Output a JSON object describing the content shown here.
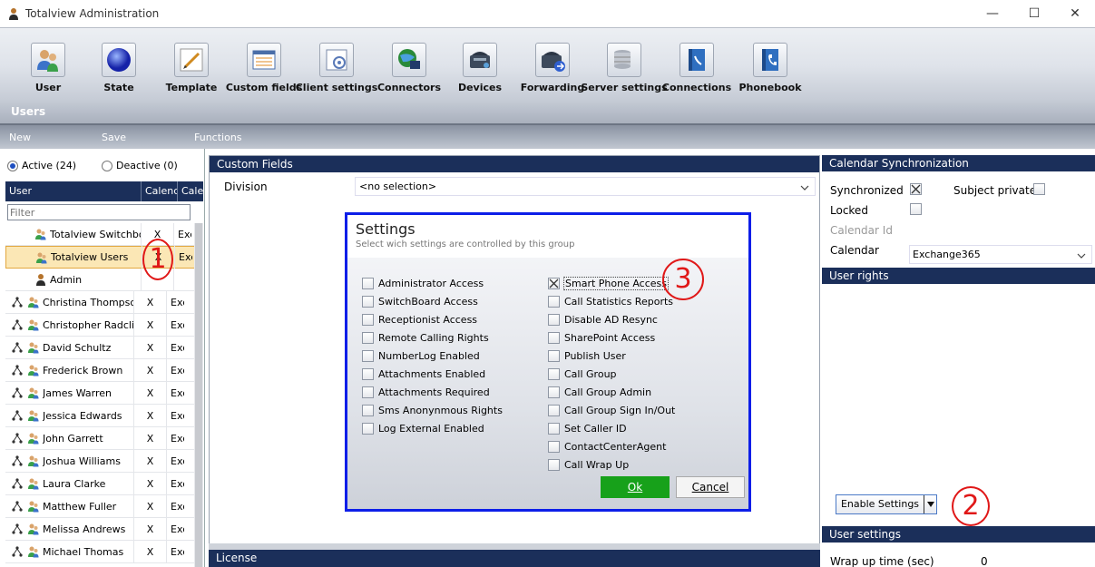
{
  "window": {
    "title": "Totalview  Administration"
  },
  "toolbar": {
    "items": [
      {
        "label": "User",
        "icon": "users-icon"
      },
      {
        "label": "State",
        "icon": "state-orb-icon"
      },
      {
        "label": "Template",
        "icon": "template-pen-icon"
      },
      {
        "label": "Custom fields",
        "icon": "custom-fields-icon"
      },
      {
        "label": "Client settings",
        "icon": "client-settings-icon"
      },
      {
        "label": "Connectors",
        "icon": "connectors-globe-icon"
      },
      {
        "label": "Devices",
        "icon": "devices-phone-icon"
      },
      {
        "label": "Forwarding",
        "icon": "forwarding-phone-icon"
      },
      {
        "label": "Server settings",
        "icon": "server-database-icon"
      },
      {
        "label": "Connections",
        "icon": "connections-book-icon"
      },
      {
        "label": "Phonebook",
        "icon": "phonebook-icon"
      }
    ],
    "section_title": "Users"
  },
  "menu": {
    "new": "New",
    "save": "Save",
    "functions": "Functions"
  },
  "left": {
    "active_label": "Active (24)",
    "deactive_label": "Deactive (0)",
    "columns": [
      "User",
      "Calenc",
      "Cale"
    ],
    "filter_placeholder": "Filter",
    "rows": [
      {
        "name": "Totalview Switchboa",
        "cal": "X",
        "cal2": "Exc",
        "tree": false
      },
      {
        "name": "Totalview Users",
        "cal": "X",
        "cal2": "Exc",
        "tree": false,
        "selected": true
      },
      {
        "name": "Admin",
        "cal": "",
        "cal2": "",
        "tree": false
      },
      {
        "name": "Christina Thompsor",
        "cal": "X",
        "cal2": "Exc",
        "tree": true
      },
      {
        "name": "Christopher Radcliff",
        "cal": "X",
        "cal2": "Exc",
        "tree": true
      },
      {
        "name": "David Schultz",
        "cal": "X",
        "cal2": "Exc",
        "tree": true
      },
      {
        "name": "Frederick Brown",
        "cal": "X",
        "cal2": "Exc",
        "tree": true
      },
      {
        "name": "James Warren",
        "cal": "X",
        "cal2": "Exc",
        "tree": true
      },
      {
        "name": "Jessica Edwards",
        "cal": "X",
        "cal2": "Exc",
        "tree": true
      },
      {
        "name": "John Garrett",
        "cal": "X",
        "cal2": "Exc",
        "tree": true
      },
      {
        "name": "Joshua Williams",
        "cal": "X",
        "cal2": "Exc",
        "tree": true
      },
      {
        "name": "Laura Clarke",
        "cal": "X",
        "cal2": "Exc",
        "tree": true
      },
      {
        "name": "Matthew Fuller",
        "cal": "X",
        "cal2": "Exc",
        "tree": true
      },
      {
        "name": "Melissa Andrews",
        "cal": "X",
        "cal2": "Exc",
        "tree": true
      },
      {
        "name": "Michael Thomas",
        "cal": "X",
        "cal2": "Exc",
        "tree": true
      }
    ]
  },
  "center": {
    "header": "Custom Fields",
    "division_label": "Division",
    "division_value": "<no selection>",
    "license_header": "License"
  },
  "dialog": {
    "title": "Settings",
    "subtitle": "Select wich settings are controlled by this group",
    "left_options": [
      {
        "label": "Administrator Access",
        "checked": false
      },
      {
        "label": "SwitchBoard Access",
        "checked": false
      },
      {
        "label": "Receptionist Access",
        "checked": false
      },
      {
        "label": "Remote Calling Rights",
        "checked": false
      },
      {
        "label": "NumberLog Enabled",
        "checked": false
      },
      {
        "label": "Attachments Enabled",
        "checked": false
      },
      {
        "label": "Attachments Required",
        "checked": false
      },
      {
        "label": "Sms Anonynmous Rights",
        "checked": false
      },
      {
        "label": "Log External Enabled",
        "checked": false
      }
    ],
    "right_options": [
      {
        "label": "Smart Phone Access",
        "checked": true
      },
      {
        "label": "Call Statistics Reports",
        "checked": false
      },
      {
        "label": "Disable AD Resync",
        "checked": false
      },
      {
        "label": "SharePoint Access",
        "checked": false
      },
      {
        "label": "Publish User",
        "checked": false
      },
      {
        "label": "Call Group",
        "checked": false
      },
      {
        "label": "Call Group Admin",
        "checked": false
      },
      {
        "label": "Call Group Sign In/Out",
        "checked": false
      },
      {
        "label": "Set Caller ID",
        "checked": false
      },
      {
        "label": "ContactCenterAgent",
        "checked": false
      },
      {
        "label": "Call Wrap Up",
        "checked": false
      }
    ],
    "ok_label": "Ok",
    "cancel_label": "Cancel"
  },
  "right": {
    "calendar_header": "Calendar Synchronization",
    "synchronized_label": "Synchronized",
    "synchronized_checked": true,
    "subject_private_label": "Subject private",
    "subject_private_checked": false,
    "locked_label": "Locked",
    "locked_checked": false,
    "calendar_id_label": "Calendar Id",
    "calendar_label": "Calendar",
    "calendar_value": "Exchange365",
    "user_rights_header": "User rights",
    "enable_settings_label": "Enable Settings",
    "user_settings_header": "User settings",
    "wrap_up_label": "Wrap up time (sec)",
    "wrap_up_value": "0"
  },
  "annotations": {
    "one": "1",
    "two": "2",
    "three": "3"
  },
  "colors": {
    "header_navy": "#1b2f5a",
    "dialog_border": "#0d1ee8",
    "ok_green": "#17a11a",
    "annotation_red": "#e01818",
    "selected_row": "#fbe7b5"
  }
}
